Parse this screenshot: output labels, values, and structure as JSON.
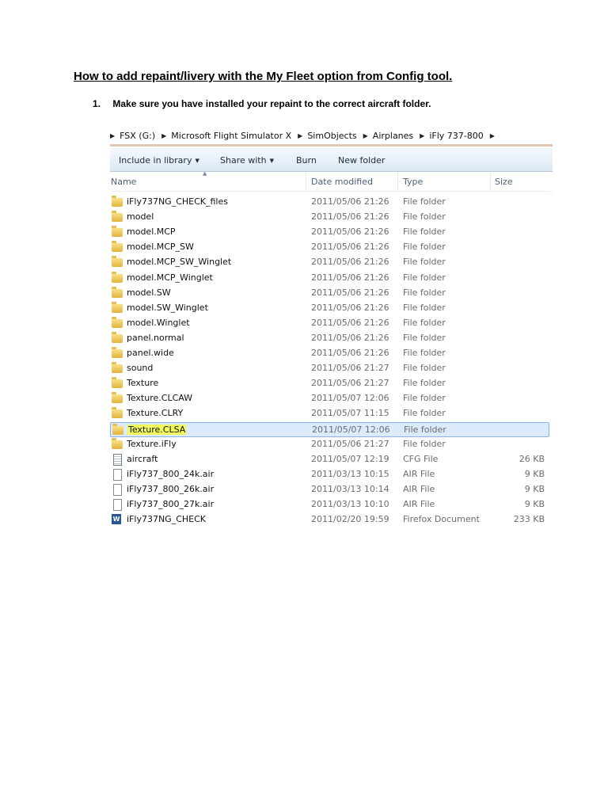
{
  "doc": {
    "title": "How to add repaint/livery with the My Fleet option from Config tool.",
    "step": {
      "number": "1.",
      "text": "Make sure you have installed your repaint to the correct aircraft folder."
    }
  },
  "explorer": {
    "breadcrumb": [
      "FSX (G:)",
      "Microsoft Flight Simulator X",
      "SimObjects",
      "Airplanes",
      "iFly 737-800"
    ],
    "toolbar": {
      "include_in_library": "Include in library",
      "share_with": "Share with",
      "burn": "Burn",
      "new_folder": "New folder"
    },
    "columns": {
      "name": "Name",
      "date": "Date modified",
      "type": "Type",
      "size": "Size"
    },
    "files": [
      {
        "name": "iFly737NG_CHECK_files",
        "date": "2011/05/06 21:26",
        "type": "File folder",
        "size": "",
        "icon": "folder-icon"
      },
      {
        "name": "model",
        "date": "2011/05/06 21:26",
        "type": "File folder",
        "size": "",
        "icon": "folder-icon"
      },
      {
        "name": "model.MCP",
        "date": "2011/05/06 21:26",
        "type": "File folder",
        "size": "",
        "icon": "folder-icon"
      },
      {
        "name": "model.MCP_SW",
        "date": "2011/05/06 21:26",
        "type": "File folder",
        "size": "",
        "icon": "folder-icon"
      },
      {
        "name": "model.MCP_SW_Winglet",
        "date": "2011/05/06 21:26",
        "type": "File folder",
        "size": "",
        "icon": "folder-icon"
      },
      {
        "name": "model.MCP_Winglet",
        "date": "2011/05/06 21:26",
        "type": "File folder",
        "size": "",
        "icon": "folder-icon"
      },
      {
        "name": "model.SW",
        "date": "2011/05/06 21:26",
        "type": "File folder",
        "size": "",
        "icon": "folder-icon"
      },
      {
        "name": "model.SW_Winglet",
        "date": "2011/05/06 21:26",
        "type": "File folder",
        "size": "",
        "icon": "folder-icon"
      },
      {
        "name": "model.Winglet",
        "date": "2011/05/06 21:26",
        "type": "File folder",
        "size": "",
        "icon": "folder-icon"
      },
      {
        "name": "panel.normal",
        "date": "2011/05/06 21:26",
        "type": "File folder",
        "size": "",
        "icon": "folder-icon"
      },
      {
        "name": "panel.wide",
        "date": "2011/05/06 21:26",
        "type": "File folder",
        "size": "",
        "icon": "folder-icon"
      },
      {
        "name": "sound",
        "date": "2011/05/06 21:27",
        "type": "File folder",
        "size": "",
        "icon": "folder-icon"
      },
      {
        "name": "Texture",
        "date": "2011/05/06 21:27",
        "type": "File folder",
        "size": "",
        "icon": "folder-icon"
      },
      {
        "name": "Texture.CLCAW",
        "date": "2011/05/07 12:06",
        "type": "File folder",
        "size": "",
        "icon": "folder-icon"
      },
      {
        "name": "Texture.CLRY",
        "date": "2011/05/07 11:15",
        "type": "File folder",
        "size": "",
        "icon": "folder-icon"
      },
      {
        "name": "Texture.CLSA",
        "date": "2011/05/07 12:06",
        "type": "File folder",
        "size": "",
        "icon": "folder-icon",
        "selected": true,
        "highlight_color": "#f2f95c"
      },
      {
        "name": "Texture.iFly",
        "date": "2011/05/06 21:27",
        "type": "File folder",
        "size": "",
        "icon": "folder-icon"
      },
      {
        "name": "aircraft",
        "date": "2011/05/07 12:19",
        "type": "CFG File",
        "size": "26 KB",
        "icon": "config-file-icon"
      },
      {
        "name": "iFly737_800_24k.air",
        "date": "2011/03/13 10:15",
        "type": "AIR File",
        "size": "9 KB",
        "icon": "file-icon"
      },
      {
        "name": "iFly737_800_26k.air",
        "date": "2011/03/13 10:14",
        "type": "AIR File",
        "size": "9 KB",
        "icon": "file-icon"
      },
      {
        "name": "iFly737_800_27k.air",
        "date": "2011/03/13 10:10",
        "type": "AIR File",
        "size": "9 KB",
        "icon": "file-icon"
      },
      {
        "name": "iFly737NG_CHECK",
        "date": "2011/02/20 19:59",
        "type": "Firefox Document",
        "size": "233 KB",
        "icon": "word-document-icon"
      }
    ]
  }
}
